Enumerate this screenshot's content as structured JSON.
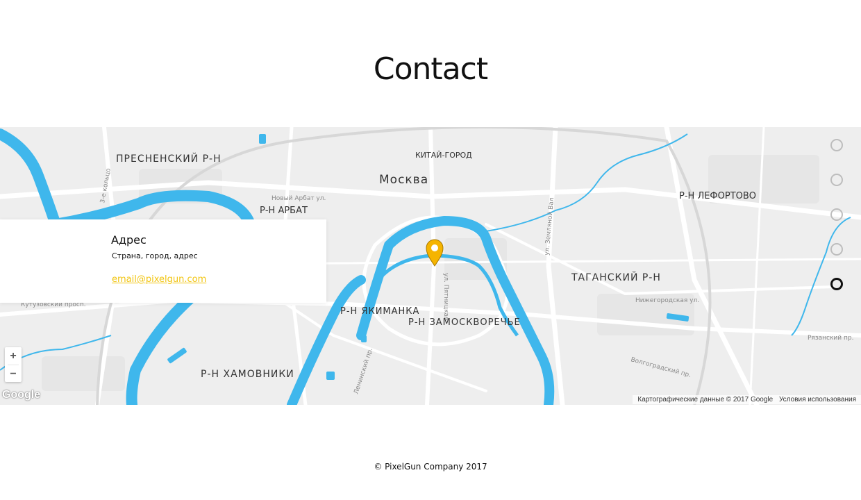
{
  "page": {
    "title": "Contact"
  },
  "map": {
    "labels": {
      "presnensky": "ПРЕСНЕНСКИЙ Р-Н",
      "kitai_gorod": "КИТАЙ-ГОРОД",
      "moskva": "Москва",
      "arbat": "Р-Н АРБАТ",
      "lefortovo": "Р-Н ЛЕФОРТОВО",
      "tagansky": "ТАГАНСКИЙ Р-Н",
      "yakimanka": "Р-Н ЯКИМАНКА",
      "zamoskvorechye": "Р-Н ЗАМОСКВОРЕЧЬЕ",
      "khamovniki": "Р-Н ХАМОВНИКИ"
    },
    "street_labels": {
      "novy_arbat": "Новый Арбат ул.",
      "zemlyanoy_val": "ул. Земляной Вал",
      "nizhegorodskaya": "Нижегородская ул.",
      "ryazansky": "Рязанский пр.",
      "volgogradsky": "Волгоградский пр.",
      "pyatnitskaya": "ул. Пятницкая",
      "leninsky": "Ленинский пр.",
      "kutuzovsky": "Кутузовский просп.",
      "tretie_koltso": "3-е кольцо"
    },
    "google_logo": "Google",
    "attribution": "Картографические данные © 2017 Google",
    "terms": "Условия использования",
    "zoom_in": "+",
    "zoom_out": "−",
    "water_color": "#3fb7ec",
    "marker_color": "#f5b400"
  },
  "contact": {
    "heading": "Адрес",
    "address": "Страна, город, адрес",
    "email": "email@pixelgun.com",
    "accent_color": "#f1c40f"
  },
  "nav_dots": {
    "count": 5,
    "active_index": 4
  },
  "footer": {
    "copyright": "© PixelGun Company 2017"
  }
}
